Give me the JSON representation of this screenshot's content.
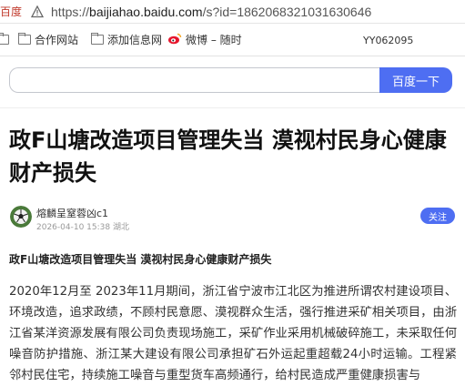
{
  "browser": {
    "site_label": "百度",
    "url_protocol": "https://",
    "url_host": "baijiahao.baidu.com",
    "url_path": "/s?id=1862068321031630646",
    "warning_icon": "warning-triangle-icon"
  },
  "bookmarks": {
    "items": [
      {
        "label": "合作网站",
        "icon": "folder-icon"
      },
      {
        "label": "添加信息网",
        "icon": "folder-icon"
      },
      {
        "label": "微博 – 随时",
        "icon": "weibo-icon"
      }
    ],
    "right_text": "YY062095"
  },
  "search": {
    "placeholder": "",
    "button_label": "百度一下"
  },
  "article": {
    "title": "政F山塘改造项目管理失当 漠视村民身心健康财产损失",
    "author_name": "熔麟呈窒蓉凶c1",
    "date": "2026-04-10 15:38",
    "location": "湖北",
    "follow_label": "关注",
    "subheading": "政F山塘改造项目管理失当 漠视村民身心健康财产损失",
    "paragraph": "2020年12月至 2023年11月期间，浙江省宁波市江北区为推进所谓农村建设项目、环境改造，追求政绩，不顾村民意愿、漠视群众生活，强行推进采矿相关项目，由浙江省某洋资源发展有限公司负责现场施工，采矿作业采用机械破碎施工，未采取任何噪音防护措施、浙江某大建设有限公司承担矿石外运起重超载24小时运输。工程紧邻村民住宅，持续施工噪音与重型货车高频通行，给村民造成严重健康损害与"
  },
  "colors": {
    "accent": "#4e6ef2",
    "site_label": "#c0392b"
  }
}
